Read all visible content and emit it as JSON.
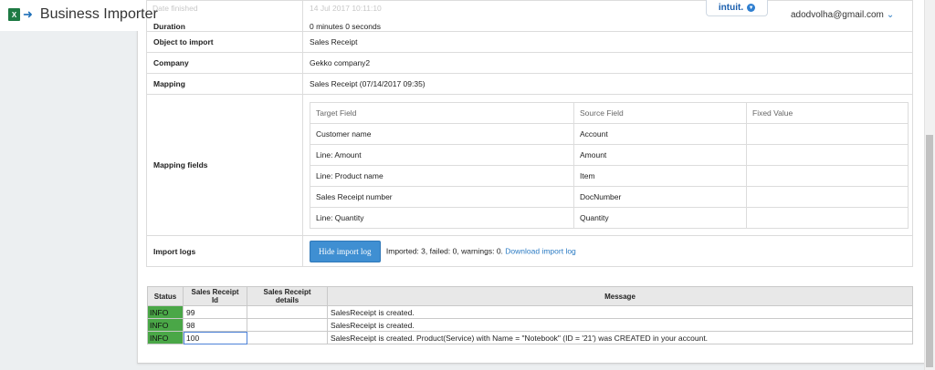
{
  "header": {
    "app_title": "Business Importer",
    "intuit_label": "intuit.",
    "user_email": "adodvolha@gmail.com",
    "ghost_date_label": "Date finished",
    "ghost_date_value": "14 Jul 2017 10:11:10"
  },
  "info": {
    "duration_label": "Duration",
    "duration_value": "0 minutes 0 seconds",
    "object_label": "Object to import",
    "object_value": "Sales Receipt",
    "company_label": "Company",
    "company_value": "Gekko company2",
    "mapping_label": "Mapping",
    "mapping_value": "Sales Receipt (07/14/2017 09:35)",
    "mapping_fields_label": "Mapping fields",
    "import_logs_label": "Import logs"
  },
  "mapping_fields": {
    "headers": [
      "Target Field",
      "Source Field",
      "Fixed Value"
    ],
    "rows": [
      {
        "target": "Customer name",
        "source": "Account",
        "fixed": ""
      },
      {
        "target": "Line: Amount",
        "source": "Amount",
        "fixed": ""
      },
      {
        "target": "Line: Product name",
        "source": "Item",
        "fixed": ""
      },
      {
        "target": "Sales Receipt number",
        "source": "DocNumber",
        "fixed": ""
      },
      {
        "target": "Line: Quantity",
        "source": "Quantity",
        "fixed": ""
      }
    ]
  },
  "import_logs": {
    "button_label": "Hide import log",
    "summary": "Imported: 3, failed: 0, warnings: 0.",
    "download_link": "Download import log"
  },
  "log_table": {
    "headers": [
      "Status",
      "Sales Receipt Id",
      "Sales Receipt details",
      "Message"
    ],
    "rows": [
      {
        "status": "INFO",
        "id": "99",
        "details": "",
        "message": "SalesReceipt is created."
      },
      {
        "status": "INFO",
        "id": "98",
        "details": "",
        "message": "SalesReceipt is created."
      },
      {
        "status": "INFO",
        "id": "100",
        "details": "",
        "message": "SalesReceipt is created. Product(Service) with Name = \"Notebook\" (ID = '21') was CREATED in your account."
      }
    ]
  },
  "colors": {
    "status_info": "#4aa747",
    "button": "#3f8fd2",
    "link": "#2b7bc3"
  }
}
